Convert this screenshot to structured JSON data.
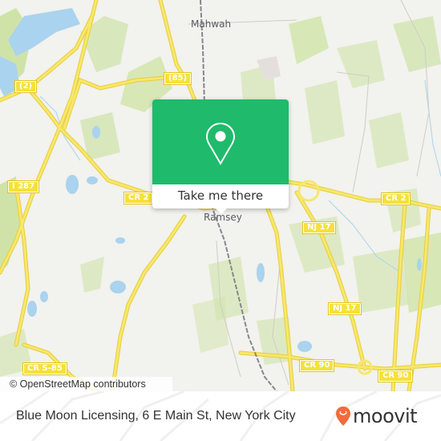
{
  "map": {
    "places": [
      {
        "id": "mahwah",
        "label": "Mahwah"
      },
      {
        "id": "ramsey",
        "label": "Ramsey"
      }
    ],
    "road_labels": [
      {
        "id": "r2",
        "label": "(2)"
      },
      {
        "id": "r85",
        "label": "(85)"
      },
      {
        "id": "i287",
        "label": "I 287"
      },
      {
        "id": "cr2w",
        "label": "CR 2"
      },
      {
        "id": "cr2e",
        "label": "CR 2"
      },
      {
        "id": "nj17a",
        "label": "NJ 17"
      },
      {
        "id": "nj17b",
        "label": "NJ 17"
      },
      {
        "id": "cr90a",
        "label": "CR 90"
      },
      {
        "id": "cr90b",
        "label": "CR 90"
      },
      {
        "id": "crs85",
        "label": "CR S-85"
      }
    ],
    "attribution": "© OpenStreetMap contributors",
    "colors": {
      "land": "#f2f2ee",
      "park": "#cfe3a8",
      "water": "#a9d3ee",
      "road": "#f6e03c",
      "rail": "#777777"
    }
  },
  "popup": {
    "icon": "location-pin-icon",
    "button_label": "Take me there",
    "accent_color": "#1fba6b"
  },
  "footer": {
    "address": "Blue Moon Licensing, 6 E Main St, New York City",
    "brand": "moovit",
    "brand_color": "#f26b3a"
  }
}
